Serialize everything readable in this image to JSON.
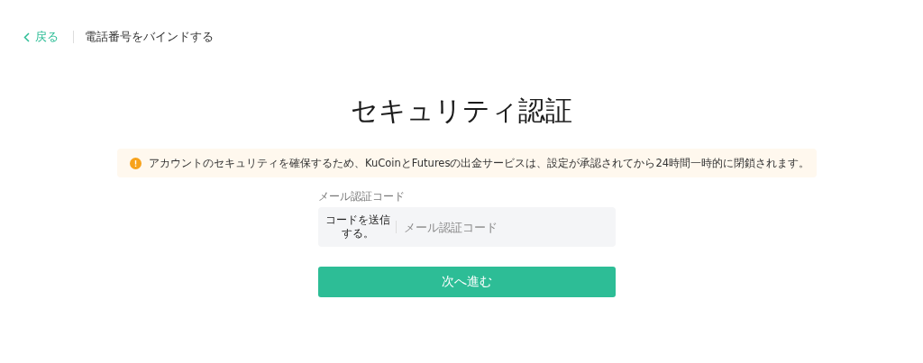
{
  "header": {
    "back": "戻る",
    "title": "電話番号をバインドする"
  },
  "heading": "セキュリティ認証",
  "notice": "アカウントのセキュリティを確保するため、KuCoinとFuturesの出金サービスは、設定が承認されてから24時間一時的に閉鎖されます。",
  "form": {
    "label": "メール認証コード",
    "send_code": "コードを送信する。",
    "placeholder": "メール認証コード"
  },
  "submit": "次へ進む"
}
